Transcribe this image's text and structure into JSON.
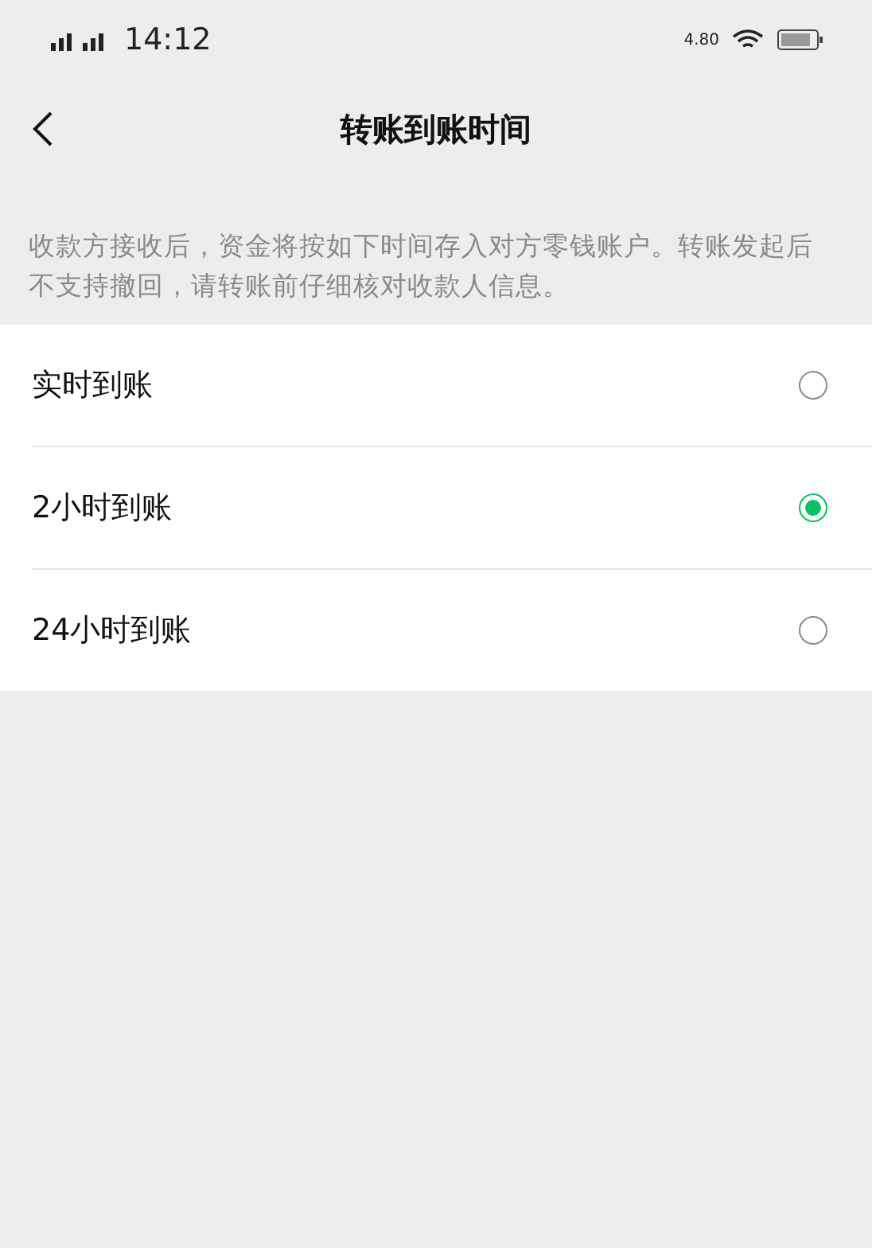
{
  "status_bar": {
    "time": "14:12",
    "speed": "4.80"
  },
  "nav": {
    "title": "转账到账时间"
  },
  "description": "收款方接收后，资金将按如下时间存入对方零钱账户。转账发起后不支持撤回，请转账前仔细核对收款人信息。",
  "options": [
    {
      "label": "实时到账",
      "selected": false
    },
    {
      "label": "2小时到账",
      "selected": true
    },
    {
      "label": "24小时到账",
      "selected": false
    }
  ]
}
